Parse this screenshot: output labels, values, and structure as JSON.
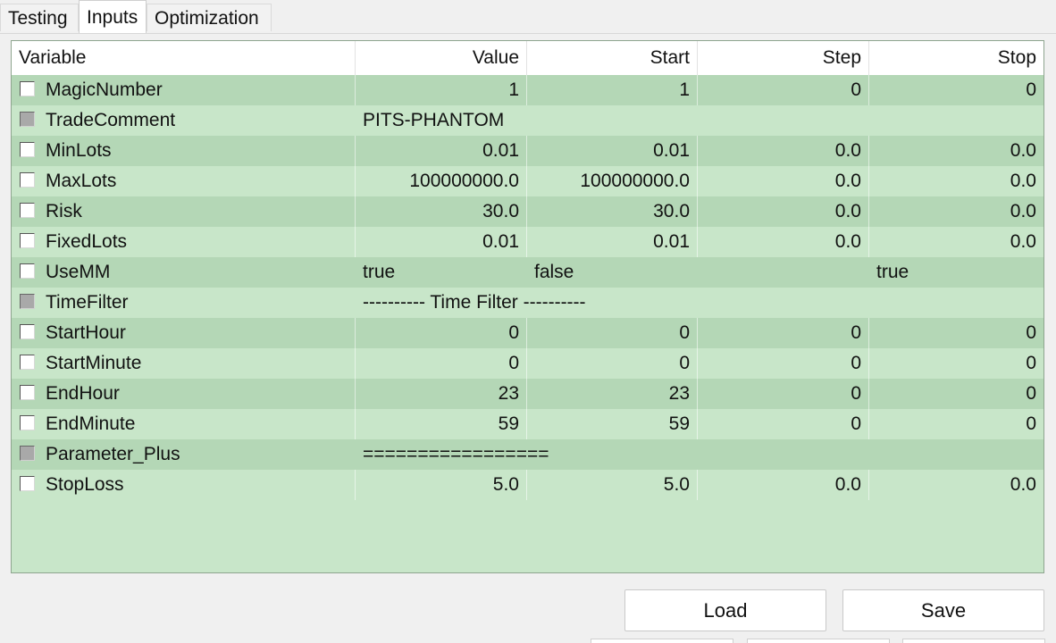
{
  "tabs": [
    "Testing",
    "Inputs",
    "Optimization"
  ],
  "active_tab": "Inputs",
  "columns": [
    "Variable",
    "Value",
    "Start",
    "Step",
    "Stop"
  ],
  "rows": [
    {
      "name": "MagicNumber",
      "value": "1",
      "start": "1",
      "step": "0",
      "stop": "0",
      "align": "right",
      "checkbox": "enabled"
    },
    {
      "name": "TradeComment",
      "value": "PITS-PHANTOM",
      "start": "",
      "step": "",
      "stop": "",
      "align": "left",
      "checkbox": "disabled"
    },
    {
      "name": "MinLots",
      "value": "0.01",
      "start": "0.01",
      "step": "0.0",
      "stop": "0.0",
      "align": "right",
      "checkbox": "enabled"
    },
    {
      "name": "MaxLots",
      "value": "100000000.0",
      "start": "100000000.0",
      "step": "0.0",
      "stop": "0.0",
      "align": "right",
      "checkbox": "enabled"
    },
    {
      "name": "Risk",
      "value": "30.0",
      "start": "30.0",
      "step": "0.0",
      "stop": "0.0",
      "align": "right",
      "checkbox": "enabled"
    },
    {
      "name": "FixedLots",
      "value": "0.01",
      "start": "0.01",
      "step": "0.0",
      "stop": "0.0",
      "align": "right",
      "checkbox": "enabled"
    },
    {
      "name": "UseMM",
      "value": "true",
      "start": "false",
      "step": "",
      "stop": "true",
      "align": "left",
      "checkbox": "enabled"
    },
    {
      "name": "TimeFilter",
      "value": "---------- Time Filter ----------",
      "start": "",
      "step": "",
      "stop": "",
      "align": "left",
      "checkbox": "disabled"
    },
    {
      "name": "StartHour",
      "value": "0",
      "start": "0",
      "step": "0",
      "stop": "0",
      "align": "right",
      "checkbox": "enabled"
    },
    {
      "name": "StartMinute",
      "value": "0",
      "start": "0",
      "step": "0",
      "stop": "0",
      "align": "right",
      "checkbox": "enabled"
    },
    {
      "name": "EndHour",
      "value": "23",
      "start": "23",
      "step": "0",
      "stop": "0",
      "align": "right",
      "checkbox": "enabled"
    },
    {
      "name": "EndMinute",
      "value": "59",
      "start": "59",
      "step": "0",
      "stop": "0",
      "align": "right",
      "checkbox": "enabled"
    },
    {
      "name": "Parameter_Plus",
      "value": "=================",
      "start": "",
      "step": "",
      "stop": "",
      "align": "left",
      "checkbox": "disabled"
    },
    {
      "name": "StopLoss",
      "value": "5.0",
      "start": "5.0",
      "step": "0.0",
      "stop": "0.0",
      "align": "right",
      "checkbox": "enabled"
    }
  ],
  "buttons": {
    "load": "Load",
    "save": "Save"
  },
  "colors": {
    "row_odd": "#b4d7b6",
    "row_even": "#c8e6c9",
    "grid_bg": "#c8e6c9"
  }
}
